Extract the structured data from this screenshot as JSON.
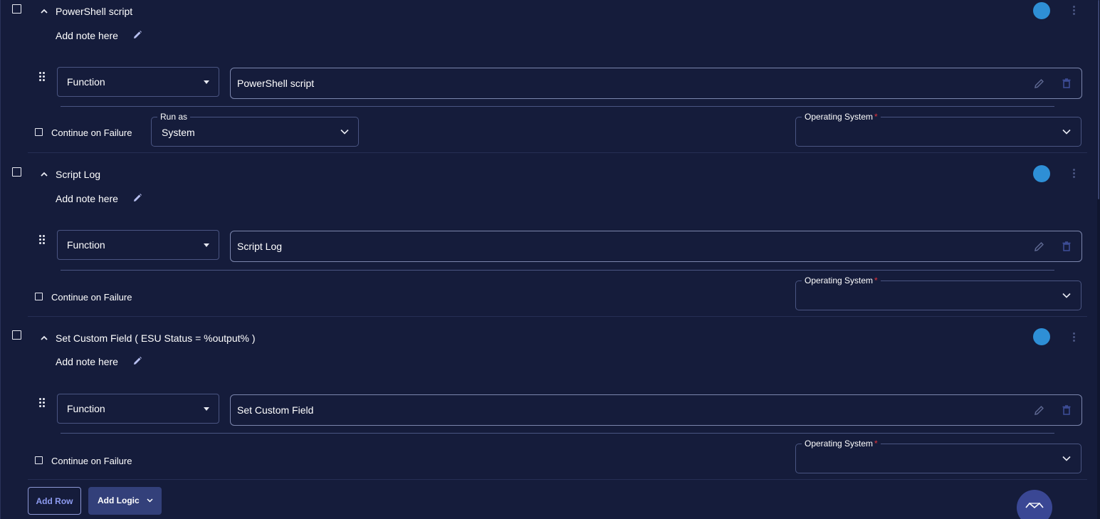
{
  "steps": [
    {
      "title": "PowerShell script",
      "note": "Add note here",
      "function_label": "Function",
      "function_value": "PowerShell script",
      "continue_on_failure": "Continue on Failure",
      "run_as": {
        "label": "Run as",
        "value": "System"
      },
      "operating_system": {
        "label": "Operating System",
        "required": "*",
        "value": ""
      },
      "status_color": "#2e8fd6"
    },
    {
      "title": "Script Log",
      "note": "Add note here",
      "function_label": "Function",
      "function_value": "Script Log",
      "continue_on_failure": "Continue on Failure",
      "operating_system": {
        "label": "Operating System",
        "required": "*",
        "value": ""
      },
      "status_color": "#2e8fd6"
    },
    {
      "title": "Set Custom Field ( ESU Status = %output% )",
      "note": "Add note here",
      "function_label": "Function",
      "function_value": "Set Custom Field",
      "continue_on_failure": "Continue on Failure",
      "operating_system": {
        "label": "Operating System",
        "required": "*",
        "value": ""
      },
      "status_color": "#2e8fd6"
    }
  ],
  "footer": {
    "add_row": "Add Row",
    "add_logic": "Add Logic"
  },
  "icons": {
    "collapse": "chevron-up-icon",
    "edit_note": "pencil-icon",
    "drag": "drag-handle-icon",
    "edit": "pencil-icon",
    "delete": "trash-icon",
    "more": "kebab-icon",
    "dropdown": "chevron-down-icon",
    "assistant": "assistant-icon"
  },
  "colors": {
    "background": "#151c3b",
    "status_dot": "#2e8fd6",
    "accent_text": "#8d9bf0",
    "button_fill": "#33407a",
    "required": "#e0323a"
  }
}
